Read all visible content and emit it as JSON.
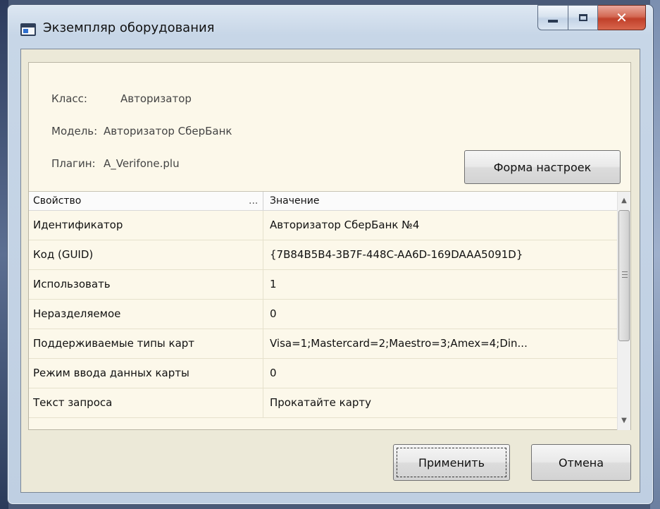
{
  "window": {
    "title": "Экземпляр оборудования"
  },
  "device": {
    "class_label": "Класс:",
    "class_value": "Авторизатор",
    "model_label": "Модель:",
    "model_value": "Авторизатор СберБанк",
    "plugin_label": "Плагин:",
    "plugin_value": "A_Verifone.plu"
  },
  "buttons": {
    "settings_form": "Форма настроек",
    "apply": "Применить",
    "cancel": "Отмена"
  },
  "grid": {
    "columns": [
      "Свойство",
      "Значение"
    ],
    "column_overflow": "...",
    "rows": [
      {
        "property": "Идентификатор",
        "value": "Авторизатор СберБанк №4"
      },
      {
        "property": "Код (GUID)",
        "value": "{7B84B5B4-3B7F-448C-AA6D-169DAAA5091D}"
      },
      {
        "property": "Использовать",
        "value": "1"
      },
      {
        "property": "Неразделяемое",
        "value": "0"
      },
      {
        "property": "Поддерживаемые типы карт",
        "value": "Visa=1;Mastercard=2;Maestro=3;Amex=4;Din..."
      },
      {
        "property": "Режим ввода данных карты",
        "value": "0"
      },
      {
        "property": "Текст запроса",
        "value": "Прокатайте карту"
      }
    ]
  },
  "scrollbar": {
    "up_icon": "▲",
    "down_icon": "▼"
  }
}
